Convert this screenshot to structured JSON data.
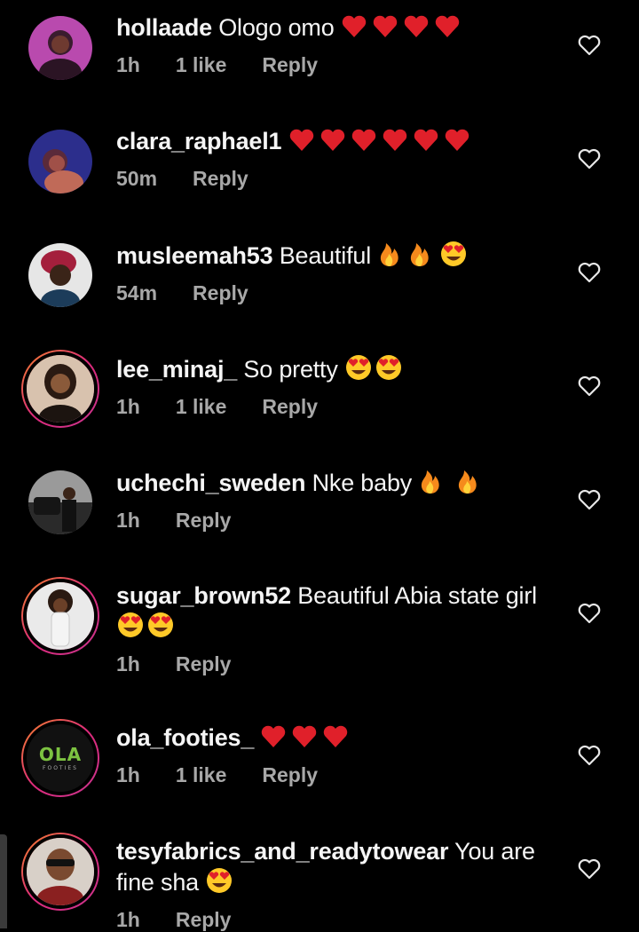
{
  "comments": [
    {
      "username": "hollaade",
      "text": "Ologo omo",
      "emojis": [
        "heart",
        "heart",
        "heart",
        "heart"
      ],
      "time": "1h",
      "likes": "1 like",
      "reply": "Reply",
      "avatar_colors": [
        "#c84ab8",
        "#3b1a36"
      ]
    },
    {
      "username": "clara_raphael1",
      "text": "",
      "emojis": [
        "heart",
        "heart",
        "heart",
        "heart",
        "heart",
        "heart"
      ],
      "time": "50m",
      "likes": "",
      "reply": "Reply",
      "avatar_colors": [
        "#2a2d8a",
        "#c46a5a"
      ]
    },
    {
      "username": "musleemah53",
      "text": "Beautiful",
      "emojis": [
        "fire",
        "fire",
        "heart-eyes"
      ],
      "time": "54m",
      "likes": "",
      "reply": "Reply",
      "avatar_colors": [
        "#e8e8e8",
        "#a02040"
      ]
    },
    {
      "username": "lee_minaj_",
      "text": "So pretty",
      "emojis": [
        "heart-eyes",
        "heart-eyes"
      ],
      "time": "1h",
      "likes": "1 like",
      "reply": "Reply",
      "avatar_colors": [
        "#d8c2ae",
        "#2a1a14"
      ]
    },
    {
      "username": "uchechi_sweden",
      "text": "Nke baby",
      "emojis": [
        "fire",
        "fire"
      ],
      "time": "1h",
      "likes": "",
      "reply": "Reply",
      "avatar_colors": [
        "#8a8a8a",
        "#1a1a1a"
      ]
    },
    {
      "username": "sugar_brown52",
      "text": "Beautiful Abia state girl",
      "emojis": [
        "heart-eyes",
        "heart-eyes"
      ],
      "time": "1h",
      "likes": "",
      "reply": "Reply",
      "avatar_colors": [
        "#e8e8e8",
        "#3a2a20"
      ]
    },
    {
      "username": "ola_footies_",
      "text": "",
      "emojis": [
        "heart",
        "heart",
        "heart"
      ],
      "time": "1h",
      "likes": "1 like",
      "reply": "Reply",
      "avatar_colors": [
        "#111111",
        "#7cc241"
      ],
      "avatar_logo": "OLA",
      "avatar_logo_sub": "FOOTIES"
    },
    {
      "username": "tesyfabrics_and_readytowear",
      "text": "You are fine sha",
      "emojis": [
        "heart-eyes"
      ],
      "time": "1h",
      "likes": "",
      "reply": "Reply",
      "avatar_colors": [
        "#d8d0c8",
        "#8a2020"
      ]
    }
  ],
  "colors": {
    "background": "#000000",
    "primary_text": "#f5f5f5",
    "secondary_text": "#a8a8a8",
    "story_ring": "#d6346f"
  }
}
